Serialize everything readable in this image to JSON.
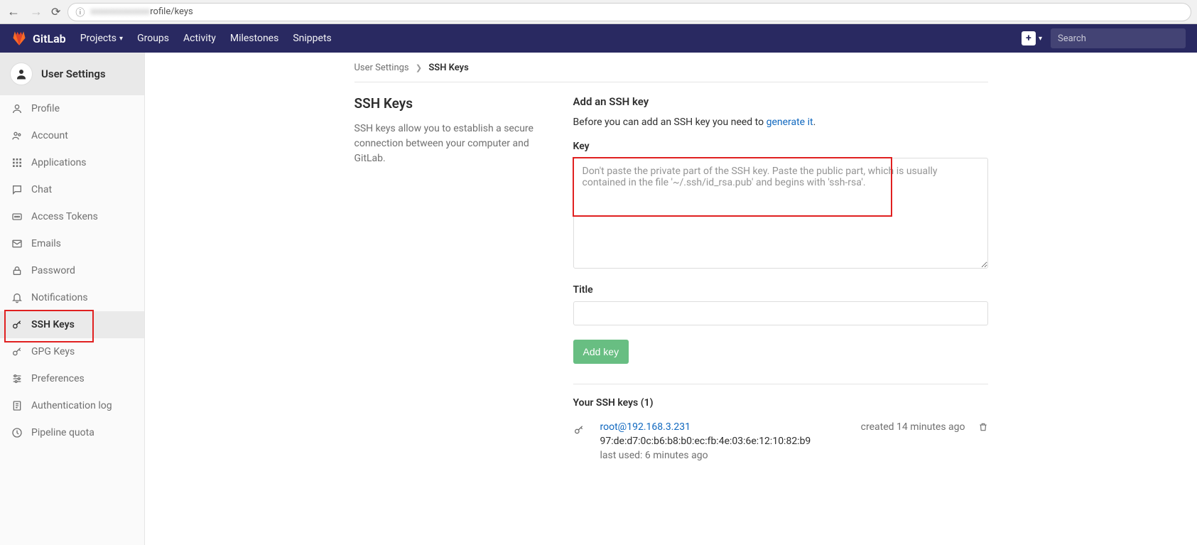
{
  "browser": {
    "url_visible": "rofile/keys"
  },
  "topbar": {
    "brand": "GitLab",
    "links": {
      "projects": "Projects",
      "groups": "Groups",
      "activity": "Activity",
      "milestones": "Milestones",
      "snippets": "Snippets"
    },
    "search_placeholder": "Search"
  },
  "sidebar": {
    "title": "User Settings",
    "items": [
      {
        "key": "profile",
        "label": "Profile"
      },
      {
        "key": "account",
        "label": "Account"
      },
      {
        "key": "applications",
        "label": "Applications"
      },
      {
        "key": "chat",
        "label": "Chat"
      },
      {
        "key": "access-tokens",
        "label": "Access Tokens"
      },
      {
        "key": "emails",
        "label": "Emails"
      },
      {
        "key": "password",
        "label": "Password"
      },
      {
        "key": "notifications",
        "label": "Notifications"
      },
      {
        "key": "ssh-keys",
        "label": "SSH Keys"
      },
      {
        "key": "gpg-keys",
        "label": "GPG Keys"
      },
      {
        "key": "preferences",
        "label": "Preferences"
      },
      {
        "key": "auth-log",
        "label": "Authentication log"
      },
      {
        "key": "pipeline-quota",
        "label": "Pipeline quota"
      }
    ]
  },
  "breadcrumbs": {
    "root": "User Settings",
    "current": "SSH Keys"
  },
  "page": {
    "heading": "SSH Keys",
    "description": "SSH keys allow you to establish a secure connection between your computer and GitLab.",
    "add_heading": "Add an SSH key",
    "help_prefix": "Before you can add an SSH key you need to ",
    "help_link": "generate it",
    "help_suffix": ".",
    "key_label": "Key",
    "key_placeholder": "Don't paste the private part of the SSH key. Paste the public part, which is usually contained in the file '~/.ssh/id_rsa.pub' and begins with 'ssh-rsa'.",
    "title_label": "Title",
    "add_button": "Add key",
    "list_heading": "Your SSH keys (1)",
    "keys": [
      {
        "name": "root@192.168.3.231",
        "fingerprint": "97:de:d7:0c:b6:b8:b0:ec:fb:4e:03:6e:12:10:82:b9",
        "last_used": "last used: 6 minutes ago",
        "created": "created 14 minutes ago"
      }
    ]
  }
}
